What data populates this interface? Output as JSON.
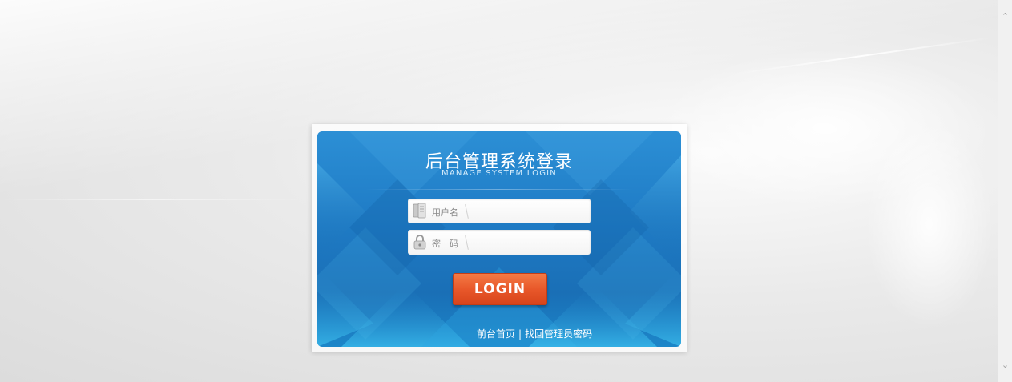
{
  "login": {
    "title_cn": "后台管理系统登录",
    "title_en": "MANAGE SYSTEM LOGIN",
    "username_label": "用户名",
    "password_label": "密　码",
    "login_button": "LOGIN"
  },
  "footer": {
    "home_link": "前台首页",
    "separator": "|",
    "recover_link": "找回管理员密码"
  },
  "icons": {
    "username": "user-card-icon",
    "password": "lock-icon",
    "scroll_up": "chevron-up-icon",
    "scroll_down": "chevron-down-icon"
  },
  "colors": {
    "panel_blue": "#1f7cc6",
    "button_orange": "#e8582a",
    "background": "#e9e9e9"
  }
}
